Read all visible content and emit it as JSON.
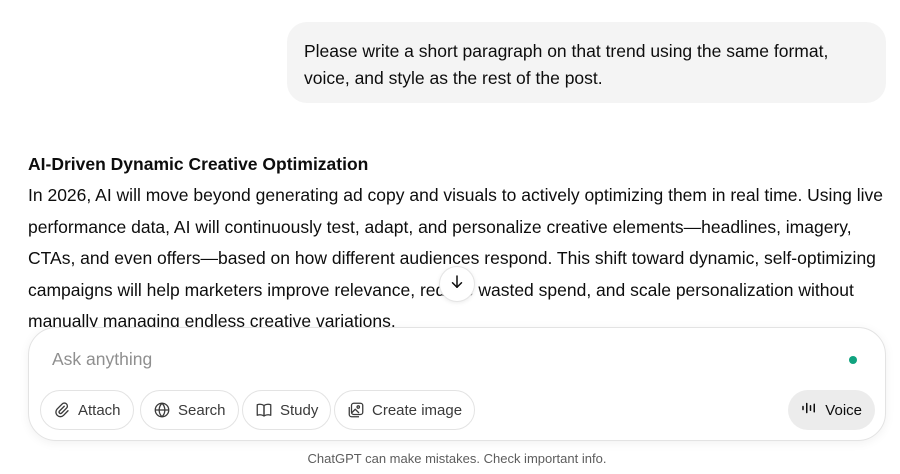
{
  "user_message": {
    "text": "Please write a short paragraph on that trend using the same format, voice, and style as the rest of the post."
  },
  "assistant_message": {
    "heading": "AI-Driven Dynamic Creative Optimization",
    "paragraph": "In 2026, AI will move beyond generating ad copy and visuals to actively optimizing them in real time. Using live performance data, AI will continuously test, adapt, and personalize creative elements—headlines, imagery, CTAs, and even offers—based on how different audiences respond. This shift toward dynamic, self-optimizing campaigns will help marketers improve relevance, reduce wasted spend, and scale personalization without manually managing endless creative variations."
  },
  "scroll_button": {
    "icon": "arrow-down-icon"
  },
  "composer": {
    "placeholder": "Ask anything",
    "status_dot_color": "#10a37f",
    "tools": [
      {
        "label": "Attach",
        "icon": "paperclip-icon"
      },
      {
        "label": "Search",
        "icon": "globe-icon"
      },
      {
        "label": "Study",
        "icon": "book-icon"
      },
      {
        "label": "Create image",
        "icon": "image-icon"
      }
    ],
    "voice_label": "Voice"
  },
  "footer": {
    "disclaimer": "ChatGPT can make mistakes. Check important info."
  }
}
